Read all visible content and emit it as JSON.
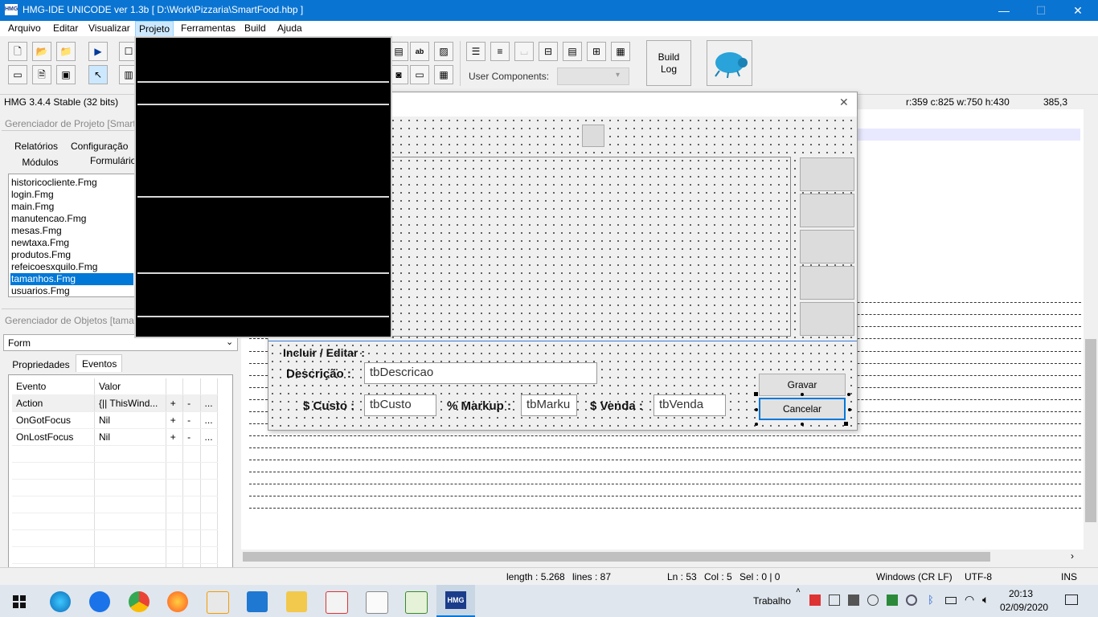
{
  "window": {
    "title": "HMG-IDE  UNICODE  ver 1.3b  [ D:\\Work\\Pizzaria\\SmartFood.hbp ]",
    "icon": "HMG",
    "minimize": "—",
    "maximize": "☐",
    "close": "✕"
  },
  "menu": {
    "items": [
      "Arquivo",
      "Editar",
      "Visualizar",
      "Projeto",
      "Ferramentas",
      "Build",
      "Ajuda"
    ],
    "active": "Projeto"
  },
  "toolbar": {
    "build_log_line1": "Build",
    "build_log_line2": "Log",
    "user_components_label": "User Components:",
    "user_components_value": ""
  },
  "status_top": {
    "version": "HMG 3.4.4 Stable (32 bits)",
    "row_info": "r:359 c:825 w:750 h:430",
    "cursor": "385,3"
  },
  "project_manager": {
    "title": "Gerenciador de Projeto [Smart",
    "tabs": [
      "Relatórios",
      "Configuração",
      "Módulos",
      "Formulário"
    ],
    "files": [
      "historicocliente.Fmg",
      "login.Fmg",
      "main.Fmg",
      "manutencao.Fmg",
      "mesas.Fmg",
      "newtaxa.Fmg",
      "produtos.Fmg",
      "refeicoesxquilo.Fmg",
      "tamanhos.Fmg",
      "usuarios.Fmg"
    ],
    "selected_index": 8
  },
  "object_manager": {
    "title": "Gerenciador de Objetos [tama",
    "combo_value": "Form",
    "tabs": [
      "Propriedades",
      "Eventos"
    ],
    "active_tab": "Eventos",
    "headers": [
      "Evento",
      "Valor"
    ],
    "rows": [
      {
        "event": "Action",
        "value": "{|| ThisWind...",
        "plus": "+",
        "minus": "-",
        "dots": "..."
      },
      {
        "event": "OnGotFocus",
        "value": "Nil",
        "plus": "+",
        "minus": "-",
        "dots": "..."
      },
      {
        "event": "OnLostFocus",
        "value": "Nil",
        "plus": "+",
        "minus": "-",
        "dots": "..."
      }
    ]
  },
  "form": {
    "close": "✕",
    "section_label": "Incluir / Editar :",
    "desc_label": "Descrição :",
    "desc_value": "tbDescricao",
    "custo_label": "$ Custo :",
    "custo_value": "tbCusto",
    "markup_label": "% Markup :",
    "markup_value": "tbMarku",
    "venda_label": "$ Venda :",
    "venda_value": "tbVenda",
    "gravar": "Gravar",
    "cancelar": "Cancelar"
  },
  "status_bottom": {
    "length": "length : 5.268",
    "lines": "lines : 87",
    "ln": "Ln : 53",
    "col": "Col : 5",
    "sel": "Sel : 0 | 0",
    "eol": "Windows (CR LF)",
    "encoding": "UTF-8",
    "mode": "INS"
  },
  "taskbar": {
    "trabalho": "Trabalho",
    "time": "20:13",
    "date": "02/09/2020"
  },
  "colors": {
    "titlebar": "#0a74d2",
    "selection": "#0078d7",
    "taskbar": "#dfe6ee"
  }
}
